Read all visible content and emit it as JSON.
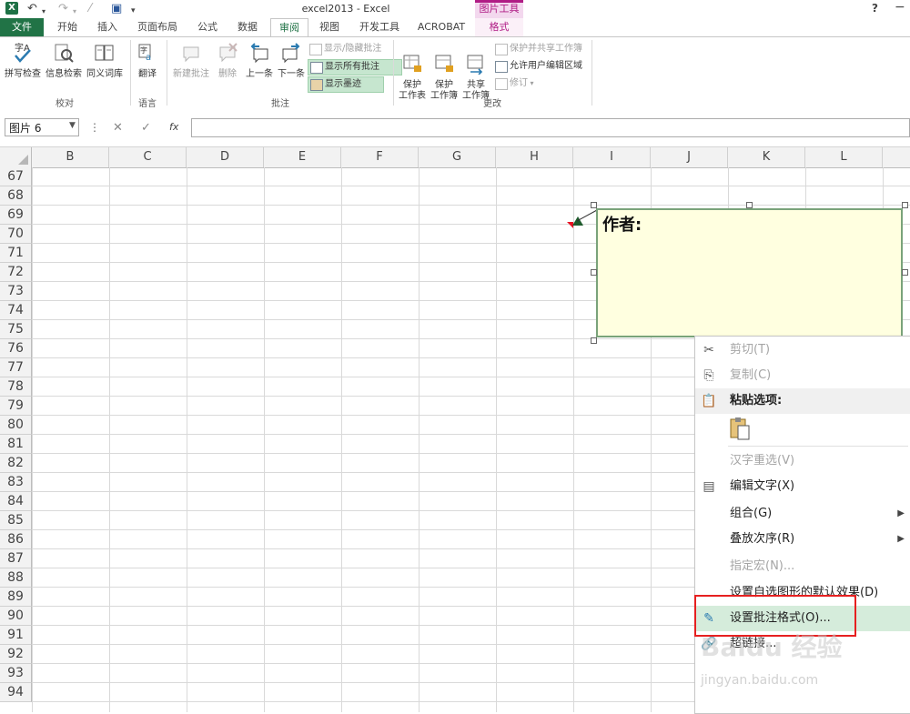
{
  "titlebar": {
    "title": "excel2013 - Excel",
    "contextual_group": "图片工具",
    "help": "?",
    "minimize": "−"
  },
  "tabs": [
    "文件",
    "开始",
    "插入",
    "页面布局",
    "公式",
    "数据",
    "审阅",
    "视图",
    "开发工具",
    "ACROBAT",
    "格式"
  ],
  "active_tab": "审阅",
  "ribbon": {
    "proofing": {
      "spell": "拼写检查",
      "research": "信息检索",
      "thesaurus": "同义词库",
      "group": "校对"
    },
    "language": {
      "translate": "翻译",
      "group": "语言"
    },
    "comments": {
      "new": "新建批注",
      "delete": "删除",
      "previous": "上一条",
      "next": "下一条",
      "show_hide": "显示/隐藏批注",
      "show_all": "显示所有批注",
      "show_ink": "显示墨迹",
      "group": "批注"
    },
    "changes": {
      "protect_sheet": "保护\n工作表",
      "protect_workbook": "保护\n工作簿",
      "share_workbook": "共享\n工作簿",
      "protect_share": "保护并共享工作簿",
      "allow_edit": "允许用户编辑区域",
      "track": "修订",
      "group": "更改"
    }
  },
  "formula_bar": {
    "namebox": "图片 6",
    "cancel": "✕",
    "enter": "✓",
    "fx": "fx",
    "content": ""
  },
  "columns": [
    "B",
    "C",
    "D",
    "E",
    "F",
    "G",
    "H",
    "I",
    "J",
    "K",
    "L"
  ],
  "rows": [
    "67",
    "68",
    "69",
    "70",
    "71",
    "72",
    "73",
    "74",
    "75",
    "76",
    "77",
    "78",
    "79",
    "80",
    "81",
    "82",
    "83",
    "84",
    "85",
    "86",
    "87",
    "88",
    "89",
    "90",
    "91",
    "92",
    "93",
    "94"
  ],
  "comment": {
    "text": "作者:"
  },
  "context_menu": {
    "cut": "剪切(T)",
    "copy": "复制(C)",
    "paste_options": "粘贴选项:",
    "reconvert": "汉字重选(V)",
    "edit_text": "编辑文字(X)",
    "group": "组合(G)",
    "order": "叠放次序(R)",
    "assign_macro": "指定宏(N)...",
    "set_default": "设置自选图形的默认效果(D)",
    "format_comment": "设置批注格式(O)...",
    "hyperlink": "超链接..."
  },
  "watermark": {
    "brand": "Baidu 经验",
    "url": "jingyan.baidu.com"
  },
  "colors": {
    "excel_green": "#217346",
    "context_pink": "#b01c85",
    "menu_highlight": "#d5ecdb",
    "comment_fill": "#ffffe0",
    "highlight_frame": "#e62020"
  }
}
